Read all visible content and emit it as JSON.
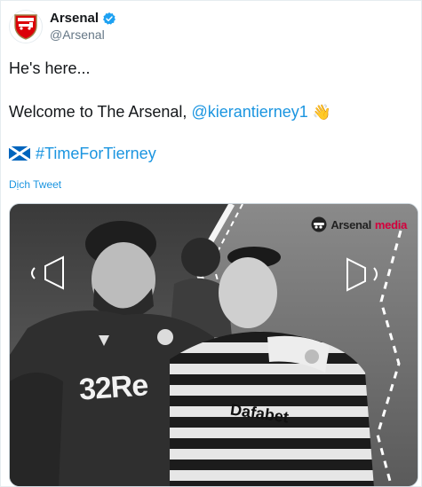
{
  "account": {
    "name": "Arsenal",
    "handle": "@Arsenal",
    "verified": true
  },
  "tweet": {
    "line1": "He's here...",
    "line2_prefix": "Welcome to The Arsenal, ",
    "line2_mention": "@kierantierney1",
    "line2_emoji": "👋",
    "line3_hashtag": "#TimeForTierney",
    "translate_label": "Dịch Tweet"
  },
  "media": {
    "brand_part1": "Arsenal",
    "brand_part2": "media",
    "sponsor_left": "32Re",
    "sponsor_right": "Dafabet"
  },
  "icons": {
    "avatar": "arsenal-crest-icon",
    "verified": "verified-badge-icon",
    "flag": "scotland-flag-icon",
    "wave": "waving-hand-icon"
  },
  "colors": {
    "link": "#1b95e0",
    "brand_red": "#d4003c",
    "verified_blue": "#1da1f2"
  }
}
